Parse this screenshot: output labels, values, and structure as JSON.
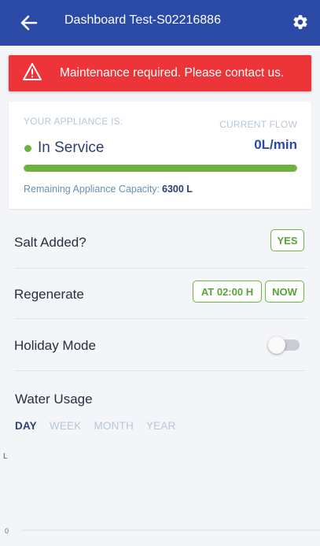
{
  "header": {
    "title": "Dashboard Test-S02216886",
    "back_icon": "arrow-left-icon",
    "settings_icon": "gear-icon"
  },
  "alert": {
    "icon": "warning-icon",
    "message": "Maintenance required. Please contact us.",
    "color": "#ec3439"
  },
  "appliance": {
    "label": "YOUR APPLIANCE IS:",
    "status": "In Service",
    "status_color": "#6db33f",
    "flow_label": "CURRENT FLOW",
    "flow_value": "0L/min",
    "capacity_fraction": 1.0,
    "capacity_label": "Remaining Appliance Capacity:",
    "capacity_value": "6300 L"
  },
  "salt": {
    "label": "Salt Added?",
    "button": "YES"
  },
  "regenerate": {
    "label": "Regenerate",
    "schedule_button": "AT 02:00 H",
    "now_button": "NOW"
  },
  "holiday": {
    "label": "Holiday Mode",
    "enabled": false
  },
  "usage": {
    "title": "Water Usage",
    "tabs": [
      "DAY",
      "WEEK",
      "MONTH",
      "YEAR"
    ],
    "active_tab": "DAY"
  },
  "chart_data": {
    "type": "bar",
    "ylabel": "L",
    "ytick_labels": [
      "0"
    ],
    "categories": [],
    "values": []
  },
  "colors": {
    "primary": "#2b4aa6",
    "accent_green": "#6db33f",
    "background": "#f3f5f9"
  }
}
